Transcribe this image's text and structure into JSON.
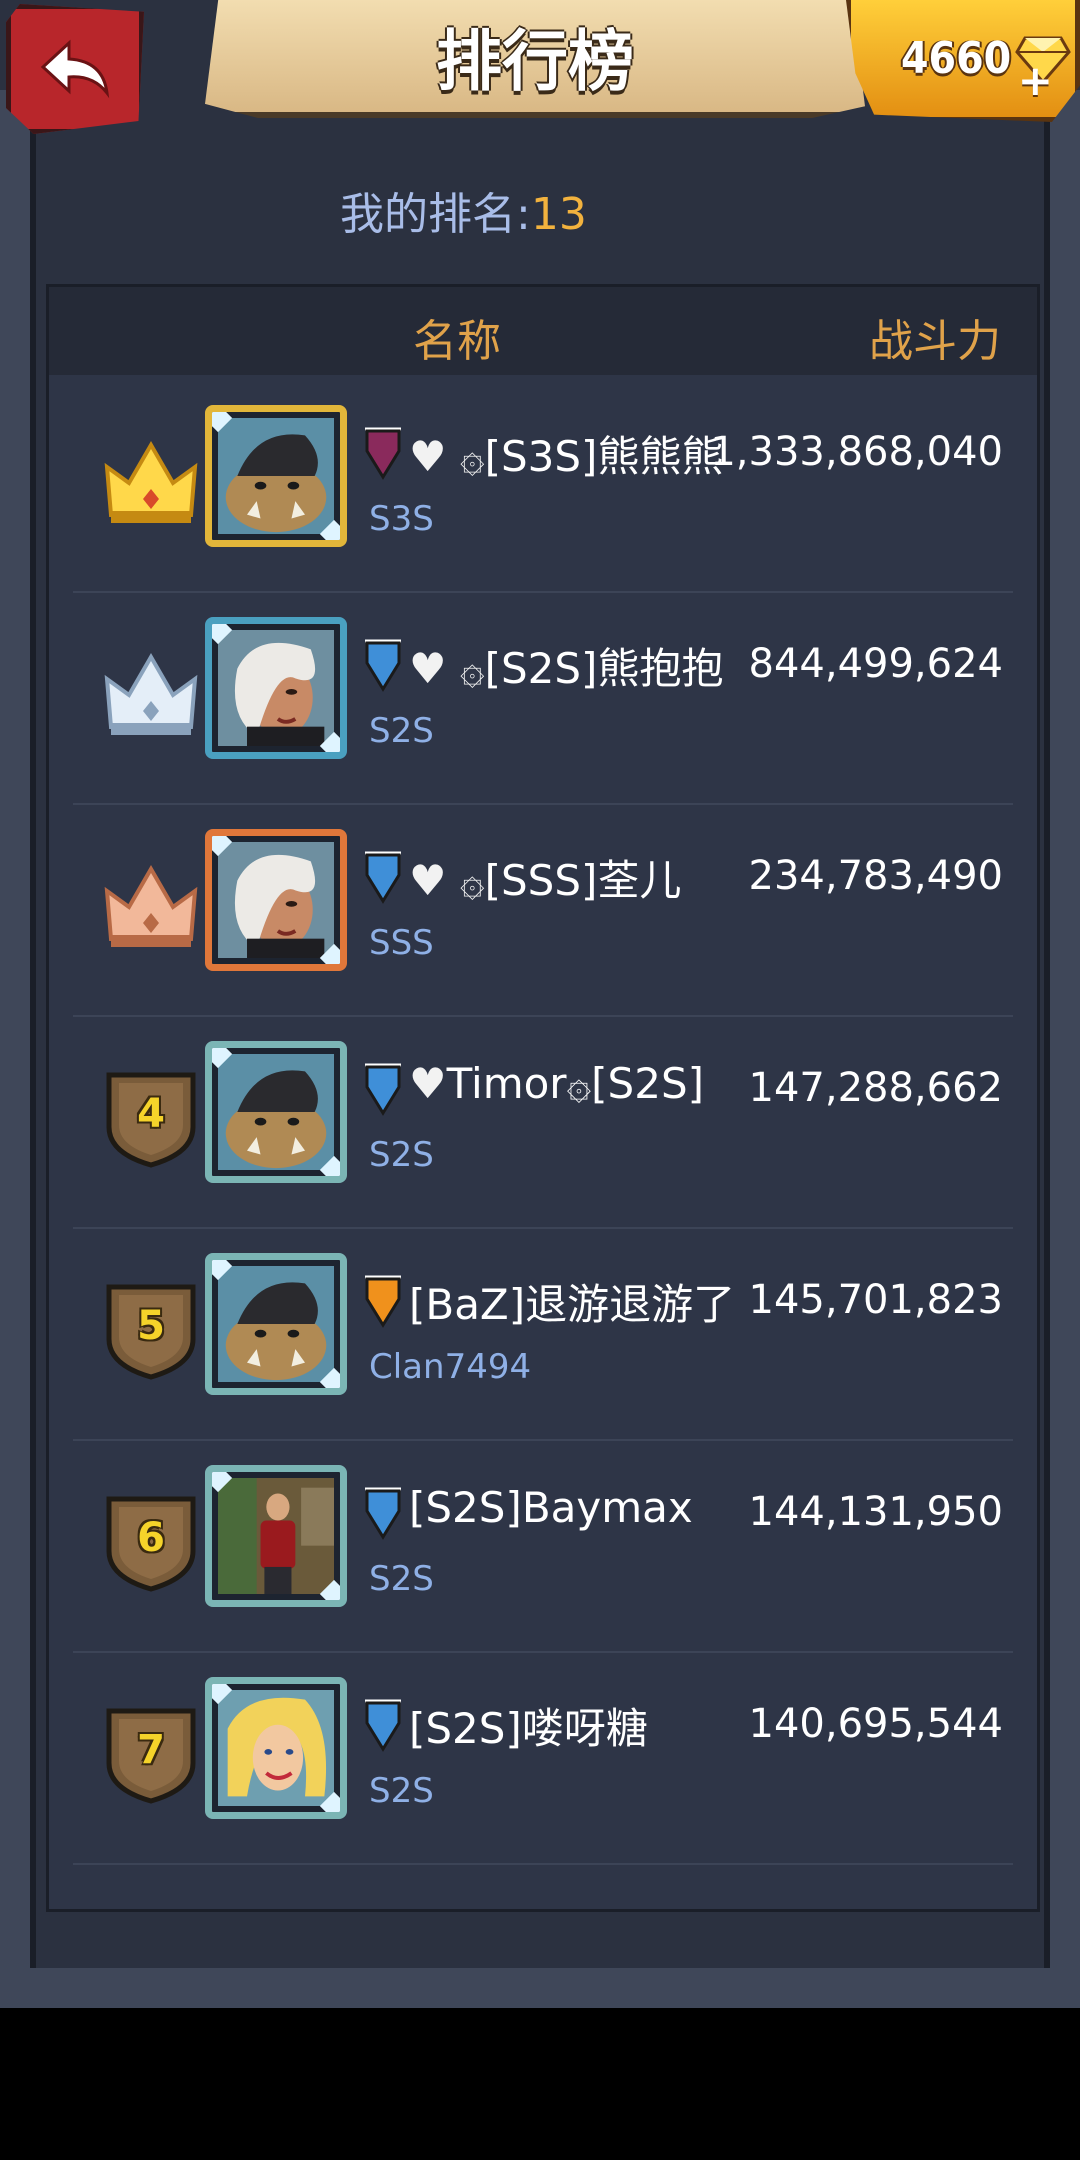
{
  "header": {
    "title": "排行榜",
    "gems": "4660",
    "gems_plus": "+"
  },
  "my_rank": {
    "label": "我的排名:",
    "value": "13"
  },
  "table": {
    "col_name": "名称",
    "col_power": "战斗力"
  },
  "rows": [
    {
      "rank": "1",
      "badge": "gold-crown",
      "frame": "gold",
      "flag": "purple",
      "prefix_icons": "♥ ۞",
      "name": "[S3S]熊熊熊",
      "clan": "S3S",
      "power": "1,333,868,040",
      "avatar": "rhino-monster"
    },
    {
      "rank": "2",
      "badge": "silver-crown",
      "frame": "silver",
      "flag": "blue",
      "prefix_icons": "♥ ۞",
      "name": "[S2S]熊抱抱",
      "clan": "S2S",
      "power": "844,499,624",
      "avatar": "white-hair-woman"
    },
    {
      "rank": "3",
      "badge": "bronze-crown",
      "frame": "bronze",
      "flag": "blue",
      "prefix_icons": "♥ ۞",
      "name": "[SSS]荃儿",
      "clan": "SSS",
      "power": "234,783,490",
      "avatar": "white-hair-woman"
    },
    {
      "rank": "4",
      "badge": "shield",
      "frame": "teal",
      "flag": "blue",
      "prefix_icons": "♥",
      "name": "Timor۞[S2S]",
      "clan": "S2S",
      "power": "147,288,662",
      "avatar": "rhino-monster"
    },
    {
      "rank": "5",
      "badge": "shield",
      "frame": "teal",
      "flag": "orange",
      "prefix_icons": "",
      "name": "[BaZ]退游退游了",
      "clan": "Clan7494",
      "power": "145,701,823",
      "avatar": "rhino-monster"
    },
    {
      "rank": "6",
      "badge": "shield",
      "frame": "teal",
      "flag": "blue",
      "prefix_icons": "",
      "name": "[S2S]Baymax",
      "clan": "S2S",
      "power": "144,131,950",
      "avatar": "photo-man"
    },
    {
      "rank": "7",
      "badge": "shield",
      "frame": "teal",
      "flag": "blue",
      "prefix_icons": "",
      "name": "[S2S]喽呀糖",
      "clan": "S2S",
      "power": "140,695,544",
      "avatar": "blonde-woman"
    }
  ],
  "colors": {
    "flag_purple": "#8a2a5c",
    "flag_blue": "#3f8fd8",
    "flag_orange": "#f0911c",
    "gold": "#e2b63a",
    "silver": "#b8d4e8",
    "bronze": "#e09a72"
  }
}
